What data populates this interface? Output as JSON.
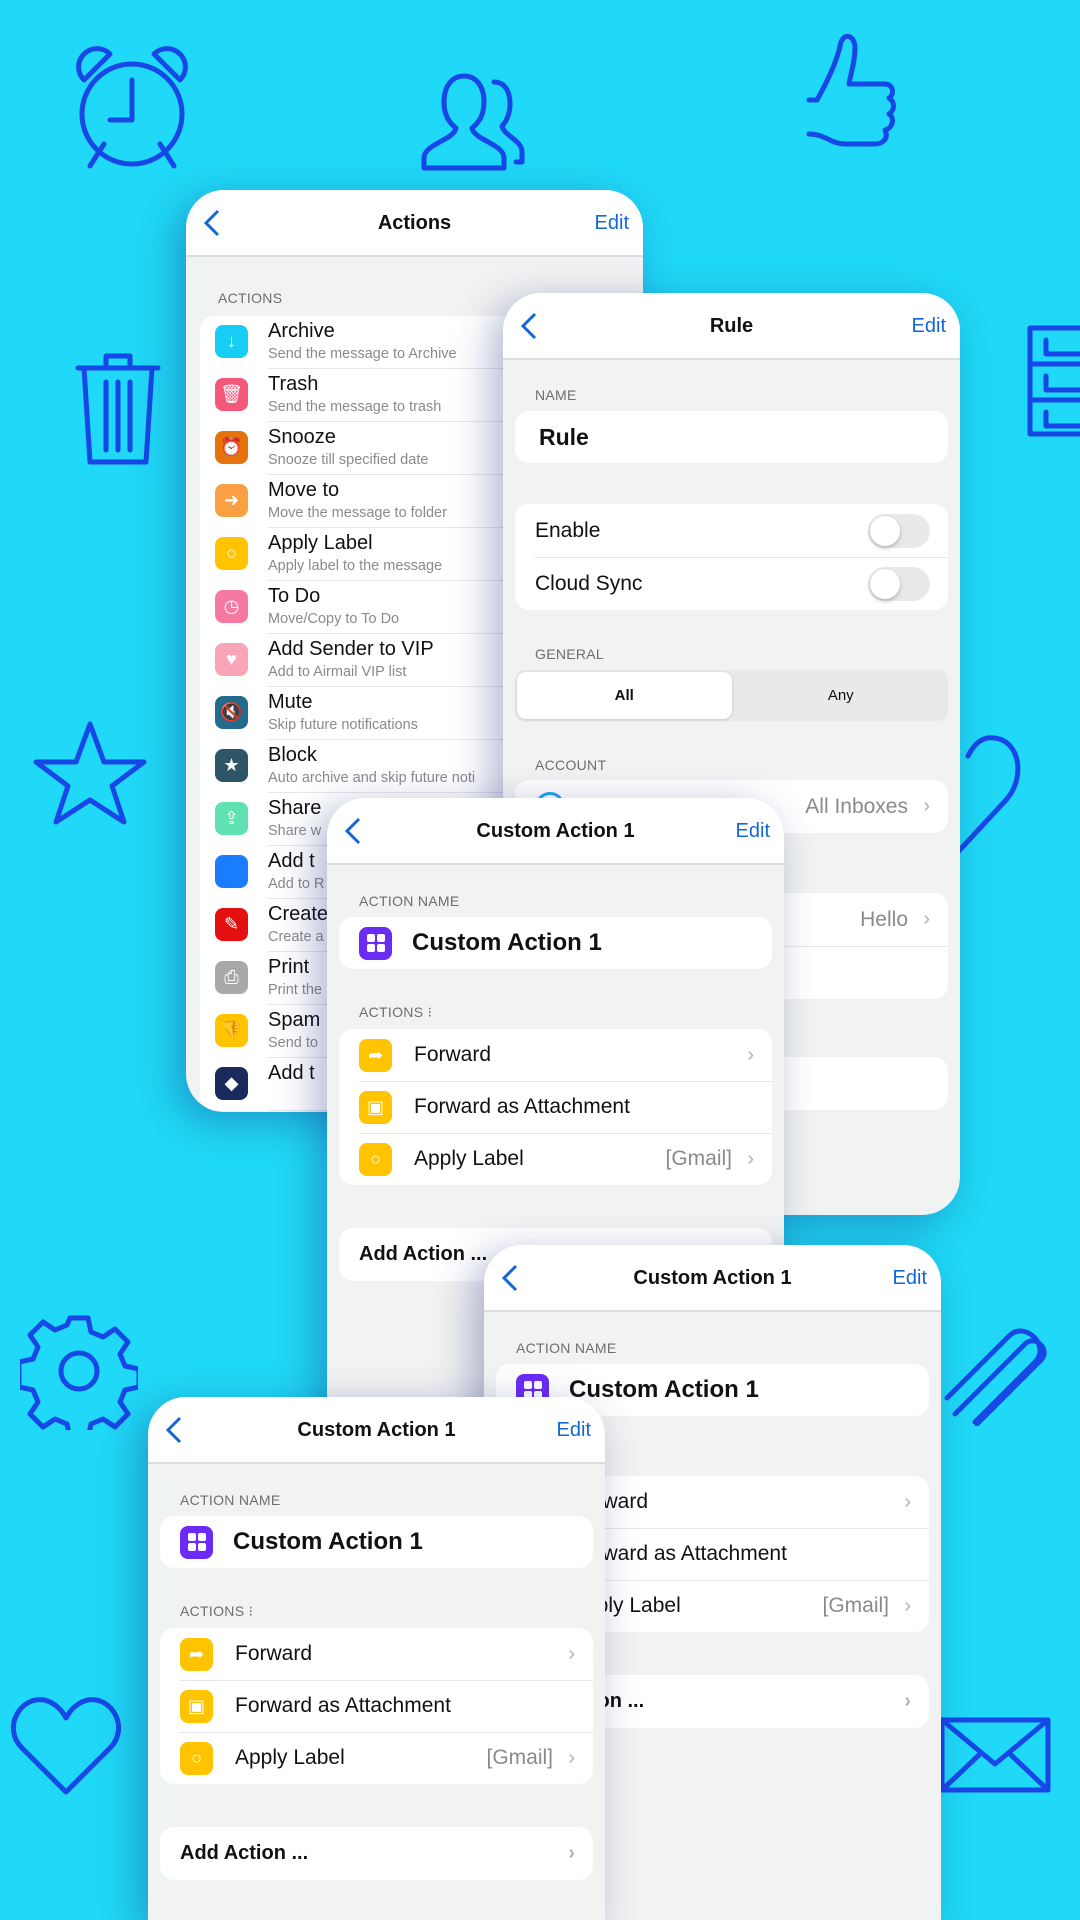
{
  "background_color": "#20d8f7",
  "icon_color": "#1747e6",
  "background_icons": [
    "alarm-clock-icon",
    "users-icon",
    "thumbs-up-icon",
    "trash-icon",
    "filing-cabinet-icon",
    "star-icon",
    "heart-icon",
    "gear-icon",
    "paperclip-icon",
    "heart-icon",
    "envelope-icon"
  ],
  "actions_screen": {
    "title": "Actions",
    "edit": "Edit",
    "section": "ACTIONS",
    "items": [
      {
        "title": "Archive",
        "subtitle": "Send the message to Archive",
        "icon": "archive-icon",
        "color": "#18cdf3",
        "glyph": "↓"
      },
      {
        "title": "Trash",
        "subtitle": "Send the message to trash",
        "icon": "trash-icon",
        "color": "#f4587a",
        "glyph": "🗑"
      },
      {
        "title": "Snooze",
        "subtitle": "Snooze till specified date",
        "icon": "alarm-icon",
        "color": "#e6720d",
        "glyph": "⏰"
      },
      {
        "title": "Move to",
        "subtitle": "Move the message to folder",
        "icon": "move-icon",
        "color": "#f9a044",
        "glyph": "➜"
      },
      {
        "title": "Apply Label",
        "subtitle": "Apply label to the message",
        "icon": "label-icon",
        "color": "#ffc300",
        "glyph": "○"
      },
      {
        "title": "To Do",
        "subtitle": "Move/Copy to To Do",
        "icon": "clock-icon",
        "color": "#f57aa2",
        "glyph": "◷"
      },
      {
        "title": "Add Sender to VIP",
        "subtitle": "Add to Airmail VIP list",
        "icon": "heart-icon",
        "color": "#f8a5b7",
        "glyph": "♥"
      },
      {
        "title": "Mute",
        "subtitle": "Skip future notifications",
        "icon": "mute-icon",
        "color": "#236b8d",
        "glyph": "🔇"
      },
      {
        "title": "Block",
        "subtitle": "Auto archive and skip future noti",
        "icon": "shield-icon",
        "color": "#2d5566",
        "glyph": "★"
      },
      {
        "title": "Share",
        "subtitle": "Share w",
        "icon": "share-icon",
        "color": "#5fe1b1",
        "glyph": "⇪"
      },
      {
        "title": "Add t",
        "subtitle": "Add to R",
        "icon": "app-icon",
        "color": "#1a7cff",
        "glyph": ""
      },
      {
        "title": "Create",
        "subtitle": "Create a",
        "icon": "pdf-icon",
        "color": "#e40f10",
        "glyph": "✎"
      },
      {
        "title": "Print",
        "subtitle": "Print the",
        "icon": "printer-icon",
        "color": "#a9a9a9",
        "glyph": "⎙"
      },
      {
        "title": "Spam",
        "subtitle": "Send to",
        "icon": "thumbs-down-icon",
        "color": "#ffc300",
        "glyph": "👎"
      },
      {
        "title": "Add t",
        "subtitle": "",
        "icon": "shortcuts-icon",
        "color": "#1b2a5c",
        "glyph": "◆"
      }
    ]
  },
  "rule_screen": {
    "title": "Rule",
    "edit": "Edit",
    "name_label": "NAME",
    "name_value": "Rule",
    "toggles": [
      {
        "label": "Enable",
        "on": false
      },
      {
        "label": "Cloud Sync",
        "on": false
      }
    ],
    "general_label": "GENERAL",
    "segments": [
      {
        "label": "All",
        "selected": true
      },
      {
        "label": "Any",
        "selected": false
      }
    ],
    "account_label": "ACCOUNT",
    "account_value": "All Inboxes",
    "condition_value": "Hello"
  },
  "custom_action": {
    "title": "Custom Action 1",
    "edit": "Edit",
    "name_label": "ACTION NAME",
    "name_value": "Custom Action 1",
    "actions_label": "ACTIONS ⁝",
    "actions": [
      {
        "label": "Forward",
        "value": "",
        "chevron": true,
        "icon": "forward-icon",
        "glyph": "➦"
      },
      {
        "label": "Forward as Attachment",
        "value": "",
        "chevron": false,
        "icon": "package-icon",
        "glyph": "▣"
      },
      {
        "label": "Apply Label",
        "value": "[Gmail]",
        "chevron": true,
        "icon": "label-icon",
        "glyph": "○"
      }
    ],
    "add_action": "Add Action ...",
    "accent": "#ffc300",
    "name_icon_color": "#6a2cf5"
  }
}
